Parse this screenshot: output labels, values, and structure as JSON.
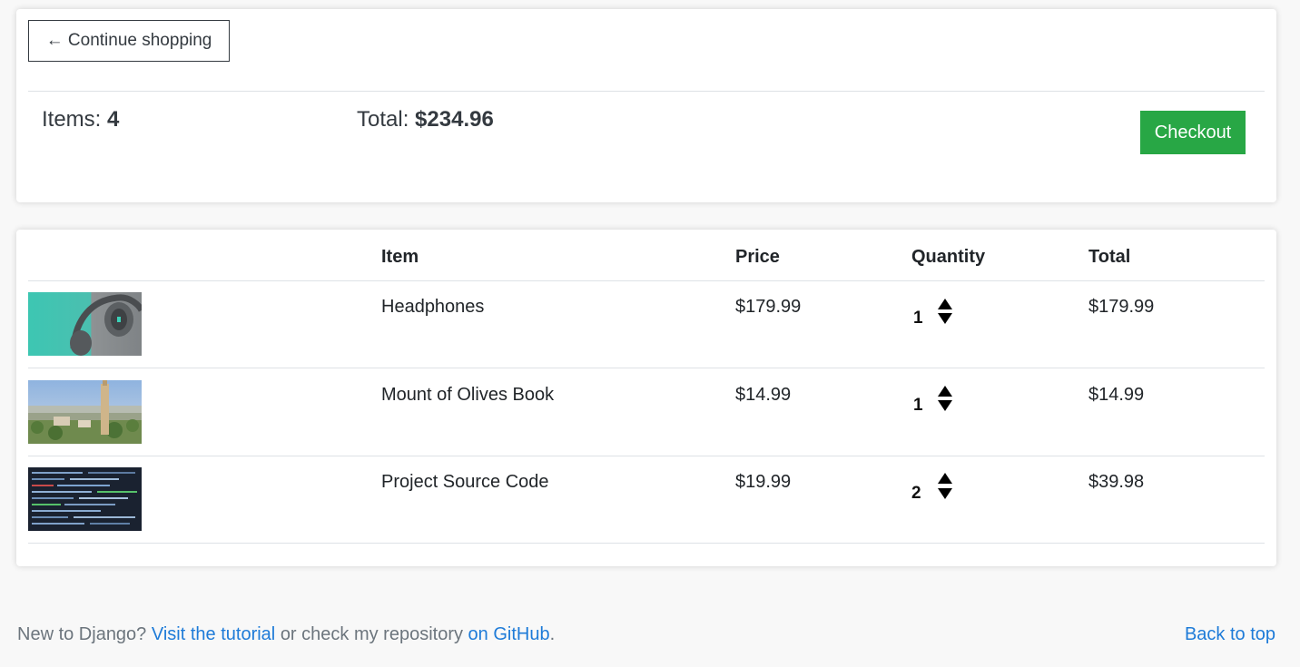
{
  "summary": {
    "continue_label": "← Continue shopping",
    "items_label": "Items:",
    "items_count": "4",
    "total_label": "Total:",
    "total_value": "$234.96",
    "checkout_label": "Checkout",
    "checkout_color": "#28a745"
  },
  "cart": {
    "headers": {
      "item": "Item",
      "price": "Price",
      "quantity": "Quantity",
      "total": "Total"
    },
    "rows": [
      {
        "name": "Headphones",
        "price": "$179.99",
        "quantity": "1",
        "total": "$179.99",
        "image": "headphones-image"
      },
      {
        "name": "Mount of Olives Book",
        "price": "$14.99",
        "quantity": "1",
        "total": "$14.99",
        "image": "mount-of-olives-image"
      },
      {
        "name": "Project Source Code",
        "price": "$19.99",
        "quantity": "2",
        "total": "$39.98",
        "image": "source-code-image"
      }
    ]
  },
  "footer": {
    "text1": "New to Django?",
    "link1": "Visit the tutorial",
    "text2": "or check my repository",
    "link2": "on GitHub",
    "text3": ".",
    "back_to_top": "Back to top",
    "link_color": "#1e7bd8"
  }
}
